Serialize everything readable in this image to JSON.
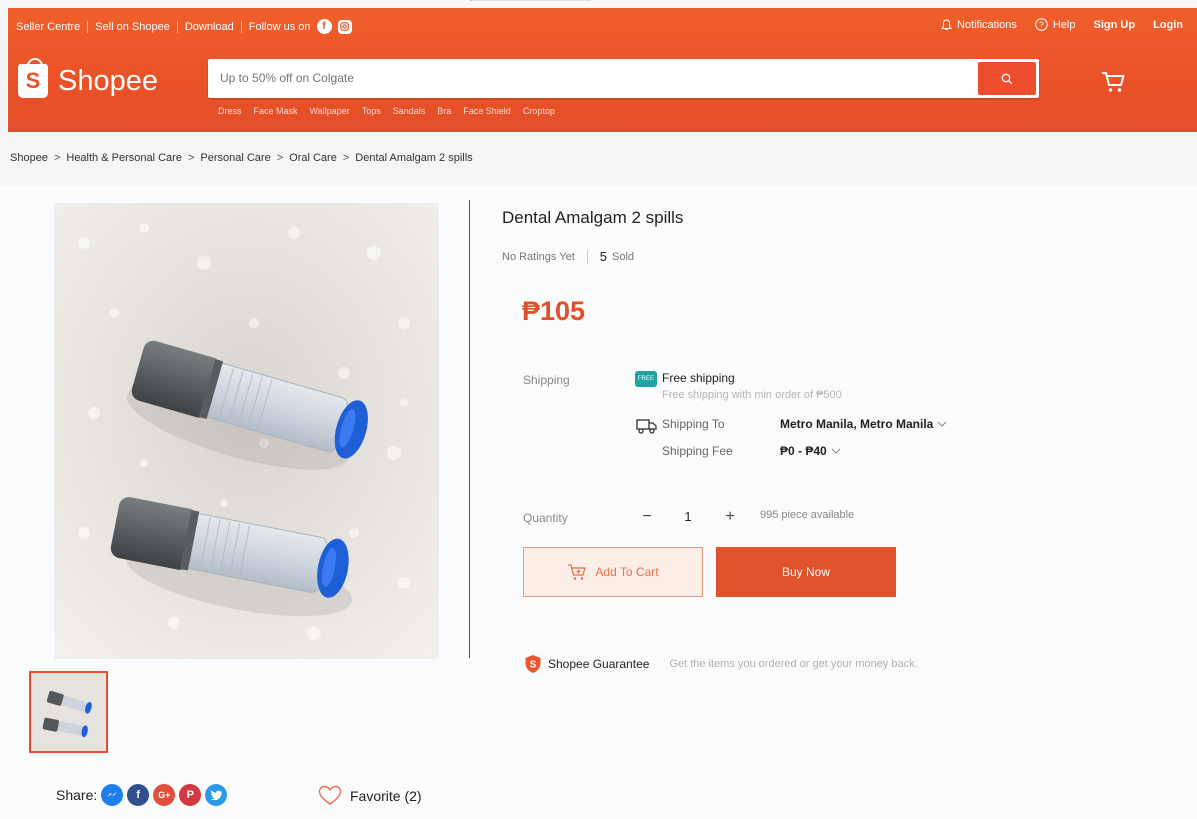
{
  "topbar": {
    "seller_centre": "Seller Centre",
    "sell_on": "Sell on Shopee",
    "download": "Download",
    "follow": "Follow us on",
    "notifications": "Notifications",
    "help": "Help",
    "signup": "Sign Up",
    "login": "Login"
  },
  "logo": {
    "glyph": "S",
    "text": "Shopee"
  },
  "search": {
    "placeholder": "Up to 50% off on Colgate",
    "hints": [
      "Dress",
      "Face Mask",
      "Wallpaper",
      "Tops",
      "Sandals",
      "Bra",
      "Face Shield",
      "Croptop"
    ]
  },
  "breadcrumb": [
    "Shopee",
    "Health & Personal Care",
    "Personal Care",
    "Oral Care",
    "Dental Amalgam 2 spills"
  ],
  "product": {
    "title": "Dental Amalgam 2 spills",
    "ratings": "No Ratings Yet",
    "sold_count": "5",
    "sold_label": "Sold",
    "price": "₱105"
  },
  "shipping": {
    "label": "Shipping",
    "free_icon_text": "FREE",
    "free_title": "Free shipping",
    "free_sub": "Free shipping with min order of ₱500",
    "to_label": "Shipping To",
    "to_value": "Metro Manila, Metro Manila",
    "fee_label": "Shipping Fee",
    "fee_value": "₱0 - ₱40"
  },
  "quantity": {
    "label": "Quantity",
    "minus": "−",
    "value": "1",
    "plus": "+",
    "available": "995 piece available"
  },
  "actions": {
    "add_to_cart": "Add To Cart",
    "buy_now": "Buy Now"
  },
  "guarantee": {
    "title": "Shopee Guarantee",
    "text": "Get the items you ordered or get your money back."
  },
  "share": {
    "label": "Share:",
    "icons": [
      "messenger-icon",
      "facebook-icon",
      "google-plus-icon",
      "pinterest-icon",
      "twitter-icon"
    ]
  },
  "favorite": {
    "label": "Favorite (2)"
  },
  "colors": {
    "brand": "#ee4d2d",
    "price": "#e1502c",
    "free_ship": "#1ea4a2"
  }
}
